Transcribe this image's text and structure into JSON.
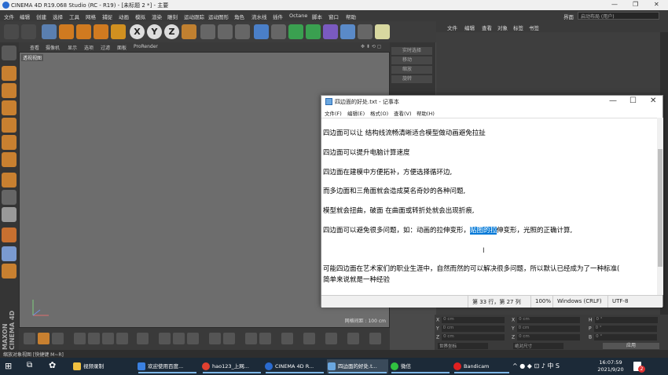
{
  "c4d": {
    "title": "CINEMA 4D R19.068 Studio (RC - R19) - [未标题 2 *] - 主要",
    "menu": [
      "文件",
      "编辑",
      "创建",
      "选择",
      "工具",
      "网格",
      "捕捉",
      "动画",
      "模拟",
      "渲染",
      "雕刻",
      "运动跟踪",
      "运动图形",
      "角色",
      "流水线",
      "插件",
      "Octane",
      "脚本",
      "窗口",
      "帮助"
    ],
    "layout_label": "界面",
    "layout_value": "启动布局 (用户)",
    "viewport_menu": [
      "查看",
      "摄像机",
      "显示",
      "选项",
      "过滤",
      "面板",
      "ProRender"
    ],
    "viewport_label": "透视视图",
    "grid_label": "网格间距 : 100 cm",
    "side_items": [
      "实时选择",
      "移动",
      "缩放",
      "旋转"
    ],
    "object_menu": [
      "文件",
      "编辑",
      "查看",
      "对象",
      "标签",
      "书签"
    ],
    "coords": {
      "rows": [
        {
          "a": "X",
          "av": "0 cm",
          "b": "X",
          "bv": "0 cm",
          "c": "H",
          "cv": "0 °"
        },
        {
          "a": "Y",
          "av": "0 cm",
          "b": "Y",
          "bv": "0 cm",
          "c": "P",
          "cv": "0 °"
        },
        {
          "a": "Z",
          "av": "0 cm",
          "b": "Z",
          "bv": "0 cm",
          "c": "B",
          "cv": "0 °"
        }
      ],
      "mode1": "世界坐标",
      "mode2": "绝对尺寸",
      "apply": "应用"
    },
    "status": "缩放对象视图 [快捷键 M~R]"
  },
  "notepad": {
    "title": "四边面的好处.txt - 记事本",
    "menu": [
      "文件(F)",
      "编辑(E)",
      "格式(O)",
      "查看(V)",
      "帮助(H)"
    ],
    "lines": [
      {
        "text": "四边面可以让 结构线流畅清晰适合模型做动画避免拉扯"
      },
      {
        "text": "四边面可以提升电脑计算速度"
      },
      {
        "text": "四边面在建模中方便拓补，方便选择循环边,"
      },
      {
        "text": "而多边面和三角面就会造成莫名奇妙的各种问题,"
      },
      {
        "text": "模型就会扭曲，破面  在曲面或转折处就会出现折痕,"
      },
      {
        "pre": "四边面可以避免很多问题，如：动画的拉伸变形，",
        "hl": "贴图的拉",
        "post": "伸变形，光照的正确计算,"
      },
      {
        "text": "可能四边面在艺术家们的职业生涯中，自然而然的可以解决很多问题，所以默认已经成为了一种标准("
      },
      {
        "text": "简单来说就是一种经验"
      }
    ],
    "status": {
      "position": "第 33 行，第 27 列",
      "zoom": "100%",
      "eol": "Windows (CRLF)",
      "encoding": "UTF-8"
    }
  },
  "taskbar": {
    "items": [
      "视频录制",
      "欢迎使用百度...",
      "hao123_上网...",
      "CINEMA 4D R...",
      "四边面的好处.t...",
      "微信",
      "Bandicam"
    ],
    "ime": "中",
    "time": "16:07:59",
    "date": "2021/9/20",
    "notify_count": "2"
  }
}
